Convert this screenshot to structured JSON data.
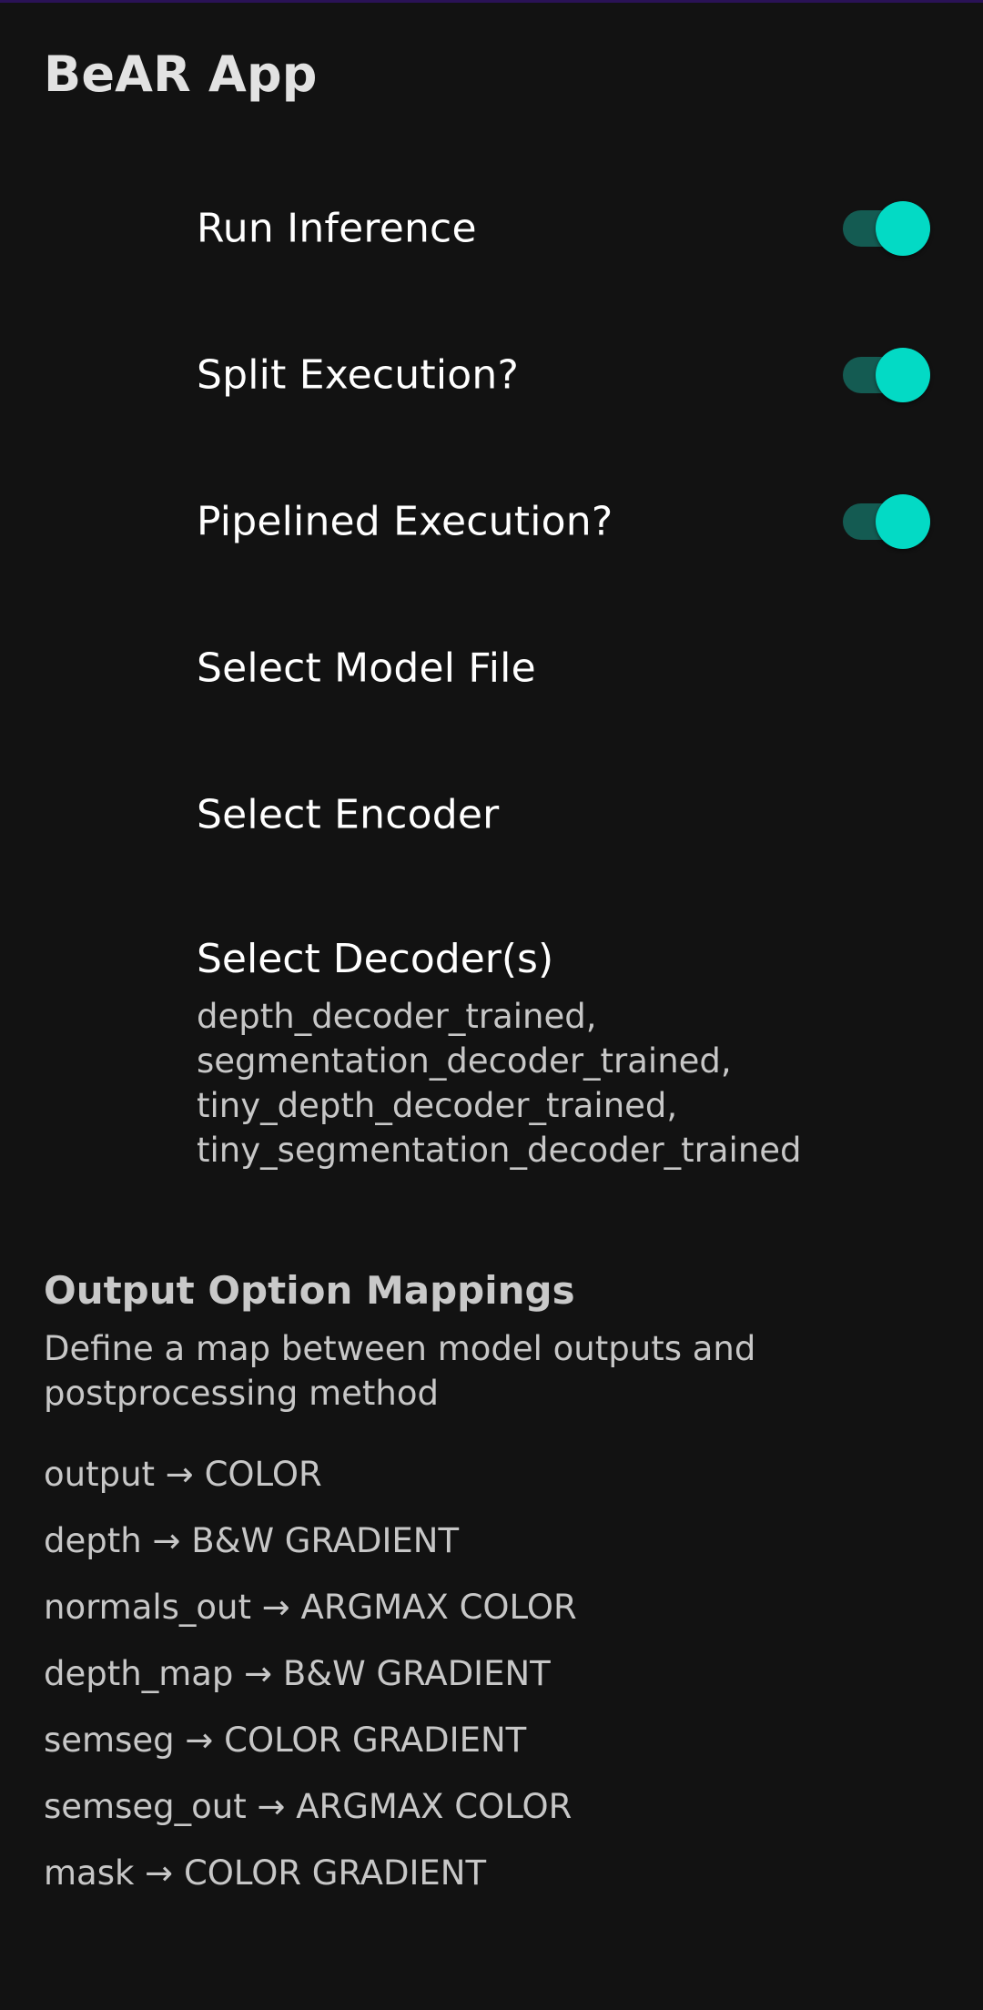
{
  "app": {
    "title": "BeAR App"
  },
  "preferences": {
    "run_inference": {
      "label": "Run Inference",
      "checked": true
    },
    "split_execution": {
      "label": "Split Execution?",
      "checked": true
    },
    "pipelined_execution": {
      "label": "Pipelined Execution?",
      "checked": true
    },
    "select_model_file": {
      "label": "Select Model File"
    },
    "select_encoder": {
      "label": "Select Encoder"
    },
    "select_decoders": {
      "label": "Select Decoder(s)",
      "summary_lines": [
        "depth_decoder_trained,",
        "segmentation_decoder_trained,",
        "tiny_depth_decoder_trained,",
        "tiny_segmentation_decoder_trained"
      ]
    }
  },
  "output_mappings": {
    "title": "Output Option Mappings",
    "description": "Define a map between model outputs and postprocessing method",
    "items": [
      "output → COLOR",
      "depth → B&W GRADIENT",
      "normals_out → ARGMAX COLOR",
      "depth_map → B&W GRADIENT",
      "semseg → COLOR GRADIENT",
      "semseg_out → ARGMAX COLOR",
      "mask → COLOR GRADIENT"
    ]
  },
  "colors": {
    "background": "#121212",
    "accent": "#03dac5",
    "switch_track": "#145b52",
    "status_bar_accent": "#2a1256"
  }
}
